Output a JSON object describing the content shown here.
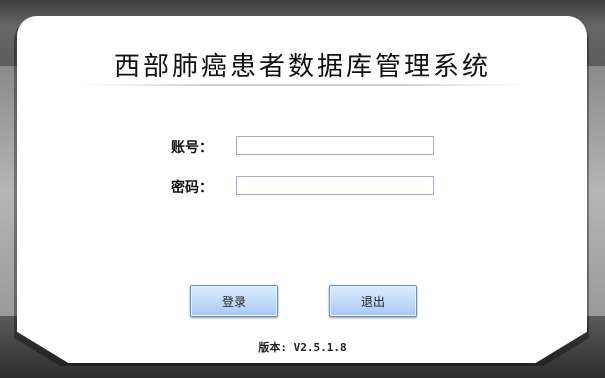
{
  "window": {
    "title": "西部肺癌患者数据库管理系统"
  },
  "form": {
    "account_label": "账号：",
    "account_value": "",
    "password_label": "密码：",
    "password_value": ""
  },
  "buttons": {
    "login_label": "登录",
    "exit_label": "退出"
  },
  "footer": {
    "version_text": "版本: V2.5.1.8"
  },
  "colors": {
    "button_gradient_top": "#dcecff",
    "button_gradient_bottom": "#a9c9f2",
    "input_border": "#9fb2c4",
    "panel_background": "#ffffff"
  }
}
